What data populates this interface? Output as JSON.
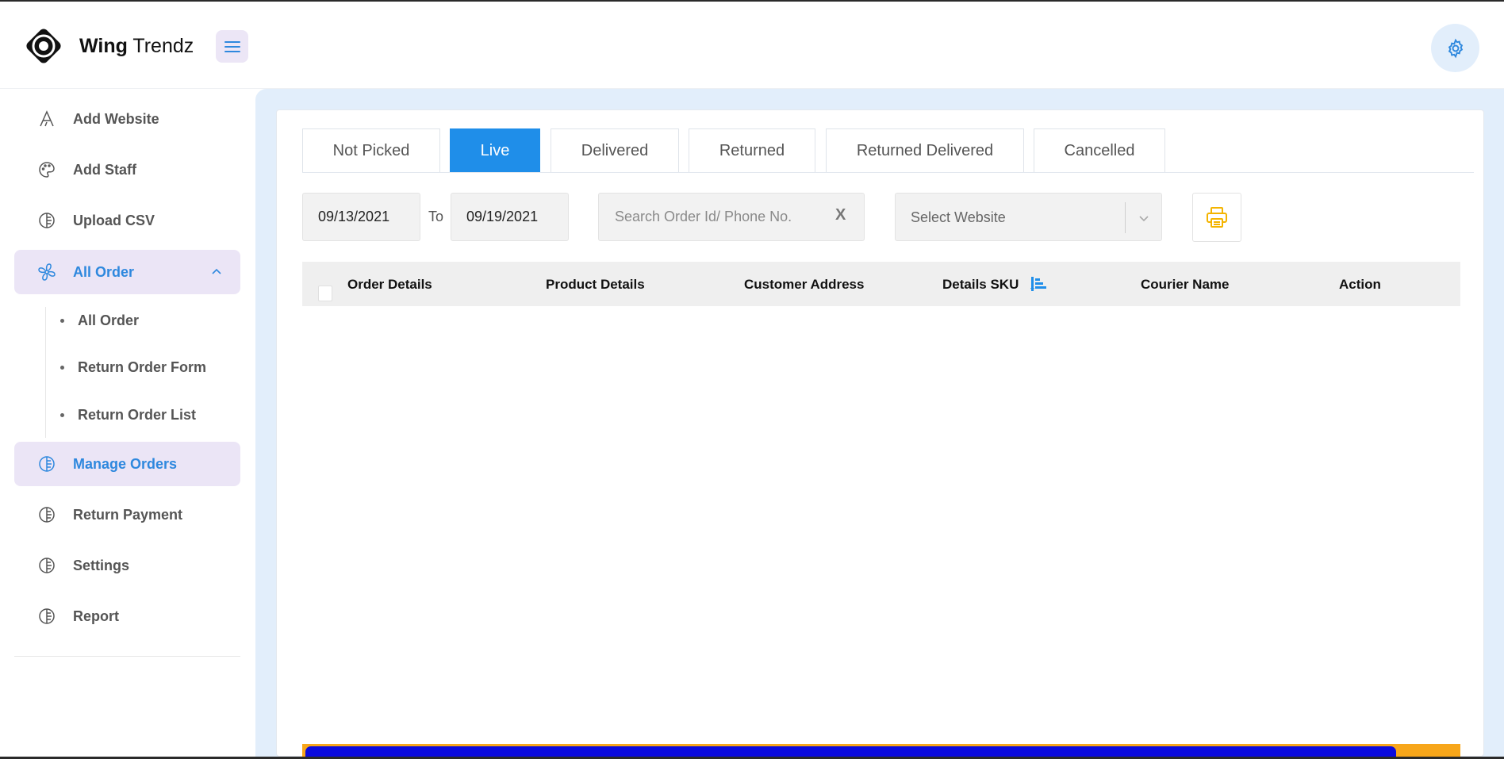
{
  "brand": {
    "name_bold": "Wing",
    "name_regular": "Trendz"
  },
  "sidebar": {
    "items": [
      {
        "label": "Add Website",
        "icon": "font-icon"
      },
      {
        "label": "Add Staff",
        "icon": "palette-icon"
      },
      {
        "label": "Upload CSV",
        "icon": "circle-lines-icon"
      },
      {
        "label": "All Order",
        "icon": "fan-icon",
        "expanded": true
      },
      {
        "label": "Manage Orders",
        "icon": "circle-lines-icon"
      },
      {
        "label": "Return Payment",
        "icon": "circle-lines-icon"
      },
      {
        "label": "Settings",
        "icon": "circle-lines-icon"
      },
      {
        "label": "Report",
        "icon": "circle-lines-icon"
      }
    ],
    "subitems": [
      {
        "label": "All Order"
      },
      {
        "label": "Return Order Form"
      },
      {
        "label": "Return Order List"
      }
    ]
  },
  "tabs": [
    {
      "label": "Not Picked"
    },
    {
      "label": "Live",
      "active": true
    },
    {
      "label": "Delivered"
    },
    {
      "label": "Returned"
    },
    {
      "label": "Returned Delivered"
    },
    {
      "label": "Cancelled"
    }
  ],
  "filters": {
    "from_date": "09/13/2021",
    "to_label": "To",
    "to_date": "09/19/2021",
    "search_placeholder": "Search Order Id/ Phone No.",
    "clear_label": "X",
    "website_placeholder": "Select Website"
  },
  "table": {
    "columns": [
      "Order Details",
      "Product Details",
      "Customer Address",
      "Details SKU",
      "Courier Name",
      "Action"
    ]
  },
  "colors": {
    "accent": "#1f8ee9",
    "active_nav_bg": "#ebe5f6",
    "main_bg": "#e2eefb",
    "print_icon": "#f4b400",
    "scroll_track": "#f7a61a",
    "scroll_thumb": "#0b0bdd"
  }
}
